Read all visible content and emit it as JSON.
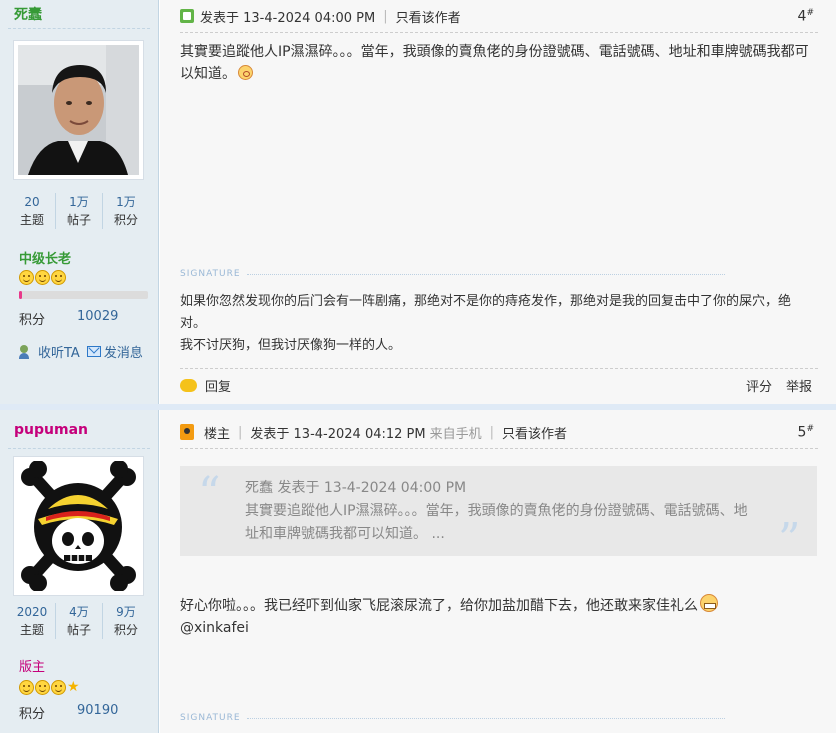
{
  "post1": {
    "author": "死蠢",
    "stats": [
      {
        "num": "20",
        "label": "主题"
      },
      {
        "num": "1万",
        "label": "帖子"
      },
      {
        "num": "1万",
        "label": "积分"
      }
    ],
    "rank": "中级长老",
    "level_faces": 3,
    "level_progress": 0.02,
    "points_label": "积分",
    "points_value": "10029",
    "follow_label": "收听TA",
    "message_label": "发消息",
    "posted_text": "发表于 13-4-2024 04:00 PM",
    "only_author_label": "只看该作者",
    "floor": "4",
    "floor_mark": "#",
    "body": "其實要追蹤他人IP濕濕碎。。。當年，我頭像的賣魚佬的身份證號碼、電話號碼、地址和車牌號碼我都可以知道。",
    "signature_label": "SIGNATURE",
    "signature_lines": [
      "如果你忽然发现你的后门会有一阵剧痛，那绝对不是你的痔疮发作，那绝对是我的回复击中了你的屎穴，绝对。",
      "我不讨厌狗，但我讨厌像狗一样的人。"
    ],
    "reply_label": "回复",
    "rate_label": "评分",
    "report_label": "举报"
  },
  "post2": {
    "author": "pupuman",
    "stats": [
      {
        "num": "2020",
        "label": "主题"
      },
      {
        "num": "4万",
        "label": "帖子"
      },
      {
        "num": "9万",
        "label": "积分"
      }
    ],
    "rank": "版主",
    "level_faces": 3,
    "level_stars": 1,
    "points_label": "积分",
    "points_value": "90190",
    "op_label": "楼主",
    "posted_text": "发表于 13-4-2024 04:12 PM",
    "device_text": "来自手机",
    "only_author_label": "只看该作者",
    "floor": "5",
    "floor_mark": "#",
    "quote_header": "死蠢 发表于 13-4-2024 04:00 PM",
    "quote_body": "其實要追蹤他人IP濕濕碎。。。當年，我頭像的賣魚佬的身份證號碼、電話號碼、地址和車牌號碼我都可以知道。 ...",
    "body": "好心你啦。。。我已经吓到仙家飞屁滚尿流了，给你加盐加醋下去，他还敢来家佳礼么",
    "mention": "@xinkafei",
    "signature_label": "SIGNATURE"
  },
  "colors": {
    "sidebar_bg": "#e5edf2",
    "content_bg": "#f7f7f7",
    "link": "#336699",
    "rank_elder": "#369a36",
    "rank_moderator": "#c5007b"
  }
}
